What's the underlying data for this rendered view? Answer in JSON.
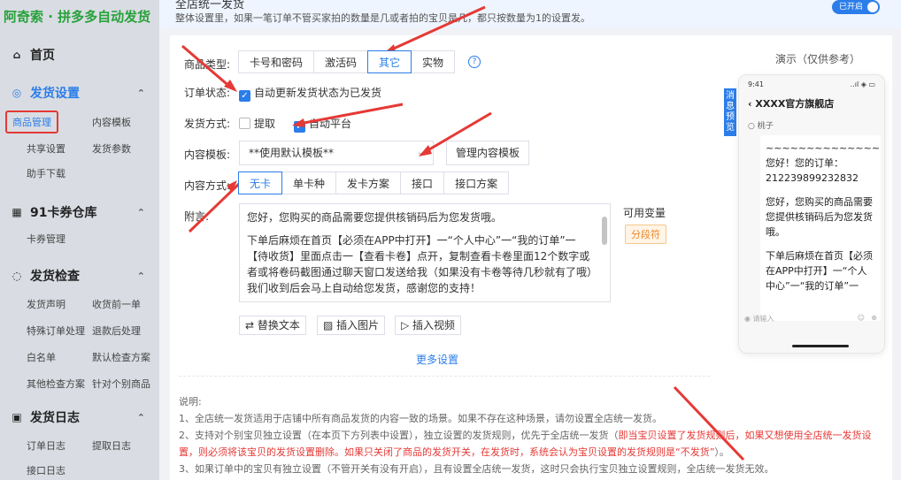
{
  "brand": "阿奇索 · 拼多多自动发货",
  "sidebar": {
    "home": "首页",
    "sections": [
      {
        "label": "发货设置",
        "items": [
          "商品管理",
          "内容模板",
          "共享设置",
          "发货参数",
          "助手下载"
        ]
      },
      {
        "label": "91卡券仓库",
        "items": [
          "卡券管理"
        ]
      },
      {
        "label": "发货检查",
        "items": [
          "发货声明",
          "收货前一单",
          "特殊订单处理",
          "退款后处理",
          "白名单",
          "默认检查方案",
          "其他检查方案",
          "针对个别商品"
        ]
      },
      {
        "label": "发货日志",
        "items": [
          "订单日志",
          "提取日志",
          "接口日志"
        ]
      }
    ]
  },
  "topbar": {
    "title": "全店统一发货",
    "desc": "整体设置里，如果一笔订单不管买家拍的数量是几或者拍的宝贝是几，都只按数量为1的设置发。",
    "toggle_label": "已开启"
  },
  "form": {
    "product_type_label": "商品类型:",
    "product_types": [
      "卡号和密码",
      "激活码",
      "其它",
      "实物"
    ],
    "product_type_selected": "其它",
    "order_status_label": "订单状态:",
    "order_status_option": "自动更新发货状态为已发货",
    "delivery_method_label": "发货方式:",
    "delivery_options": [
      "提取",
      "自动平台"
    ],
    "content_template_label": "内容模板:",
    "content_template_value": "**使用默认模板**",
    "manage_template_button": "管理内容模板",
    "content_method_label": "内容方式:",
    "content_methods": [
      "无卡",
      "单卡种",
      "发卡方案",
      "接口",
      "接口方案"
    ],
    "content_method_selected": "无卡",
    "note_label": "附言:",
    "note_paragraph_1": "您好，您购买的商品需要您提供核销码后为您发货哦。",
    "note_paragraph_2": "下单后麻烦在首页【必须在APP中打开】一“个人中心”一“我的订单”一【待收货】里面点击一【查看卡卷】点开，复制查看卡卷里面12个数字或者或将卷码截图通过聊天窗口发送给我（如果没有卡卷等待几秒就有了哦）我们收到后会马上自动给您发货，感谢您的支持！",
    "vars_label": "可用变量",
    "vars_tag": "分段符",
    "tool_replace": "替换文本",
    "tool_insert_image": "插入图片",
    "tool_insert_video": "插入视频",
    "more_settings": "更多设置"
  },
  "notes": {
    "heading": "说明:",
    "line1": "1、全店统一发货适用于店铺中所有商品发货的内容一致的场景。如果不存在这种场景，请勿设置全店统一发货。",
    "line2a": "2、支持对个别宝贝独立设置（在本页下方列表中设置），独立设置的发货规则，优先于全店统一发货（",
    "line2b": "即当宝贝设置了发货规则后，如果又想使用全店统一发货设置，则必须将该宝贝的发货设置删除。如果只关闭了商品的发货开关，在发货时，系统会认为宝贝设置的发货规则是“不发货”",
    "line2c": "）。",
    "line3": "3、如果订单中的宝贝有独立设置（不管开关有没有开启），且有设置全店统一发货，这时只会执行宝贝独立设置规则，全店统一发货无效。"
  },
  "preview": {
    "title": "演示（仅供参考）",
    "side_tag": "消息预览",
    "time": "9:41",
    "signal": "..ıl ◈ ▭",
    "shop": "XXXX官方旗舰店",
    "user": "桃子",
    "msg_1": "~~~~~~~~~~~~~~~~~~~~您好！您的订单：212239899232832",
    "msg_2": "您好，您购买的商品需要您提供核销码后为您发货哦。",
    "msg_3": "下单后麻烦在首页【必须在APP中打开】一“个人中心”一“我的订单”一",
    "input_placeholder": "请输入"
  },
  "colors": {
    "accent": "#2b7de9",
    "brand_green": "#27a13a",
    "warning_red": "#e53935",
    "annotation_arrow": "#e53935"
  }
}
